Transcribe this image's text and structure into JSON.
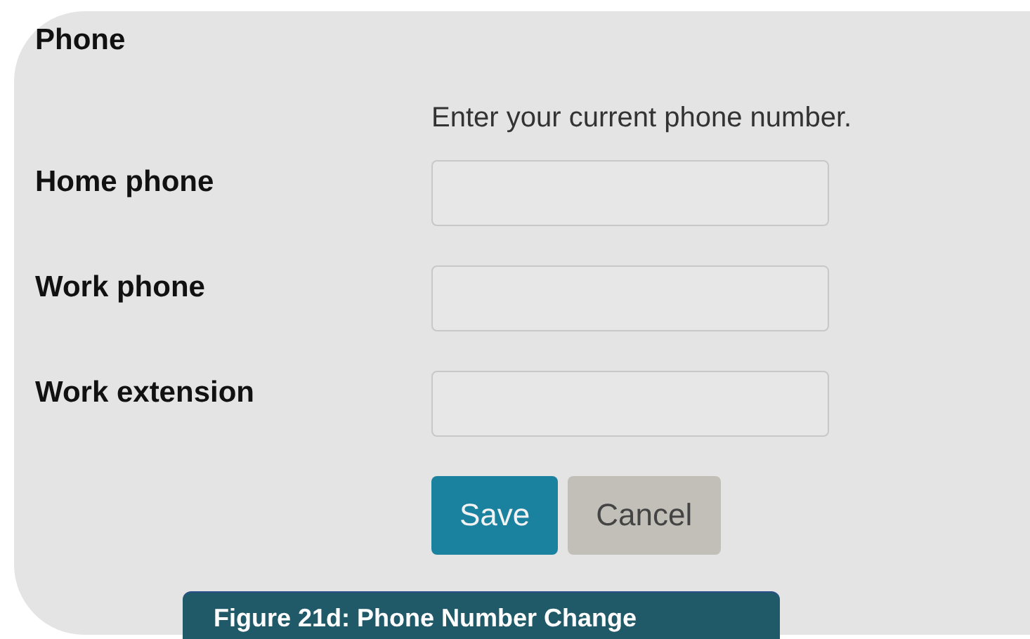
{
  "section": {
    "title": "Phone",
    "instruction": "Enter your current phone number."
  },
  "fields": [
    {
      "label": "Home phone"
    },
    {
      "label": "Work phone"
    },
    {
      "label": "Work extension"
    }
  ],
  "buttons": [
    {
      "label": "Save",
      "kind": "primary"
    },
    {
      "label": "Cancel",
      "kind": "secondary"
    }
  ],
  "caption": "Figure 21d: Phone Number Change"
}
